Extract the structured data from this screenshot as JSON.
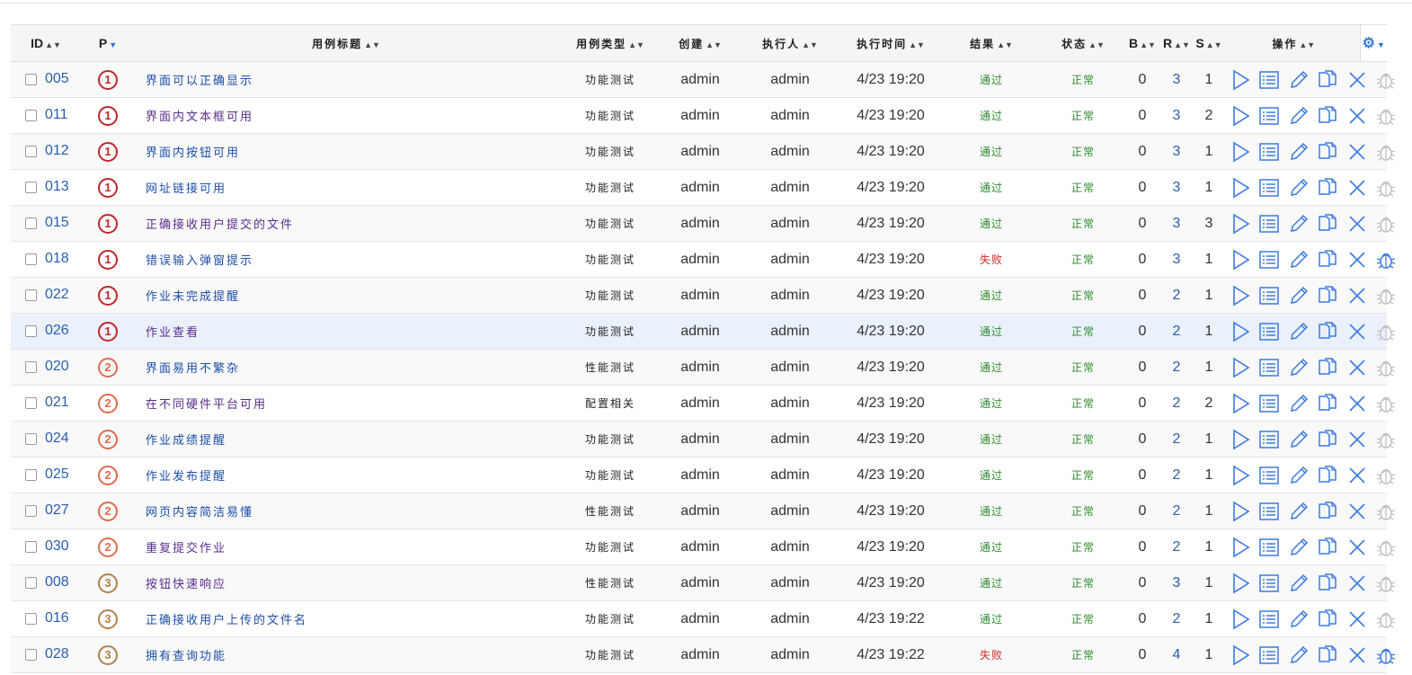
{
  "columns": {
    "id": "ID",
    "p": "P",
    "title": "用例标题",
    "type": "用例类型",
    "creator": "创建",
    "executor": "执行人",
    "time": "执行时间",
    "result": "结果",
    "status": "状态",
    "b": "B",
    "r": "R",
    "s": "S",
    "actions": "操作"
  },
  "icons": {
    "sort": "sort-icon",
    "settings": "gear-icon",
    "run": "play-icon",
    "results": "list-icon",
    "edit": "pencil-icon",
    "copy": "copy-icon",
    "delete": "close-icon",
    "bug": "bug-icon"
  },
  "colors": {
    "link": "#2a5db0",
    "pass": "#2e8b2e",
    "fail": "#d12a2a",
    "p1": "#c0262d",
    "p2": "#e06a4f",
    "p3": "#b3804a",
    "action": "#3b7be0"
  },
  "rows": [
    {
      "id": "005",
      "p": "1",
      "title": "界面可以正确显示",
      "type": "功能测试",
      "creator": "admin",
      "executor": "admin",
      "time": "4/23 19:20",
      "result": "通过",
      "status": "正常",
      "b": "0",
      "r": "3",
      "s": "1",
      "bug_active": false
    },
    {
      "id": "011",
      "p": "1",
      "title": "界面内文本框可用",
      "type": "功能测试",
      "creator": "admin",
      "executor": "admin",
      "time": "4/23 19:20",
      "result": "通过",
      "status": "正常",
      "b": "0",
      "r": "3",
      "s": "2",
      "bug_active": false
    },
    {
      "id": "012",
      "p": "1",
      "title": "界面内按钮可用",
      "type": "功能测试",
      "creator": "admin",
      "executor": "admin",
      "time": "4/23 19:20",
      "result": "通过",
      "status": "正常",
      "b": "0",
      "r": "3",
      "s": "1",
      "bug_active": false
    },
    {
      "id": "013",
      "p": "1",
      "title": "网址链接可用",
      "type": "功能测试",
      "creator": "admin",
      "executor": "admin",
      "time": "4/23 19:20",
      "result": "通过",
      "status": "正常",
      "b": "0",
      "r": "3",
      "s": "1",
      "bug_active": false
    },
    {
      "id": "015",
      "p": "1",
      "title": "正确接收用户提交的文件",
      "type": "功能测试",
      "creator": "admin",
      "executor": "admin",
      "time": "4/23 19:20",
      "result": "通过",
      "status": "正常",
      "b": "0",
      "r": "3",
      "s": "3",
      "bug_active": false
    },
    {
      "id": "018",
      "p": "1",
      "title": "错误输入弹窗提示",
      "type": "功能测试",
      "creator": "admin",
      "executor": "admin",
      "time": "4/23 19:20",
      "result": "失败",
      "status": "正常",
      "b": "0",
      "r": "3",
      "s": "1",
      "bug_active": true
    },
    {
      "id": "022",
      "p": "1",
      "title": "作业未完成提醒",
      "type": "功能测试",
      "creator": "admin",
      "executor": "admin",
      "time": "4/23 19:20",
      "result": "通过",
      "status": "正常",
      "b": "0",
      "r": "2",
      "s": "1",
      "bug_active": false
    },
    {
      "id": "026",
      "p": "1",
      "title": "作业查看",
      "type": "功能测试",
      "creator": "admin",
      "executor": "admin",
      "time": "4/23 19:20",
      "result": "通过",
      "status": "正常",
      "b": "0",
      "r": "2",
      "s": "1",
      "bug_active": false
    },
    {
      "id": "020",
      "p": "2",
      "title": "界面易用不繁杂",
      "type": "性能测试",
      "creator": "admin",
      "executor": "admin",
      "time": "4/23 19:20",
      "result": "通过",
      "status": "正常",
      "b": "0",
      "r": "2",
      "s": "1",
      "bug_active": false
    },
    {
      "id": "021",
      "p": "2",
      "title": "在不同硬件平台可用",
      "type": "配置相关",
      "creator": "admin",
      "executor": "admin",
      "time": "4/23 19:20",
      "result": "通过",
      "status": "正常",
      "b": "0",
      "r": "2",
      "s": "2",
      "bug_active": false
    },
    {
      "id": "024",
      "p": "2",
      "title": "作业成绩提醒",
      "type": "功能测试",
      "creator": "admin",
      "executor": "admin",
      "time": "4/23 19:20",
      "result": "通过",
      "status": "正常",
      "b": "0",
      "r": "2",
      "s": "1",
      "bug_active": false
    },
    {
      "id": "025",
      "p": "2",
      "title": "作业发布提醒",
      "type": "功能测试",
      "creator": "admin",
      "executor": "admin",
      "time": "4/23 19:20",
      "result": "通过",
      "status": "正常",
      "b": "0",
      "r": "2",
      "s": "1",
      "bug_active": false
    },
    {
      "id": "027",
      "p": "2",
      "title": "网页内容简洁易懂",
      "type": "性能测试",
      "creator": "admin",
      "executor": "admin",
      "time": "4/23 19:20",
      "result": "通过",
      "status": "正常",
      "b": "0",
      "r": "2",
      "s": "1",
      "bug_active": false
    },
    {
      "id": "030",
      "p": "2",
      "title": "重复提交作业",
      "type": "功能测试",
      "creator": "admin",
      "executor": "admin",
      "time": "4/23 19:20",
      "result": "通过",
      "status": "正常",
      "b": "0",
      "r": "2",
      "s": "1",
      "bug_active": false
    },
    {
      "id": "008",
      "p": "3",
      "title": "按钮快速响应",
      "type": "性能测试",
      "creator": "admin",
      "executor": "admin",
      "time": "4/23 19:20",
      "result": "通过",
      "status": "正常",
      "b": "0",
      "r": "3",
      "s": "1",
      "bug_active": false
    },
    {
      "id": "016",
      "p": "3",
      "title": "正确接收用户上传的文件名",
      "type": "功能测试",
      "creator": "admin",
      "executor": "admin",
      "time": "4/23 19:22",
      "result": "通过",
      "status": "正常",
      "b": "0",
      "r": "2",
      "s": "1",
      "bug_active": false
    },
    {
      "id": "028",
      "p": "3",
      "title": "拥有查询功能",
      "type": "功能测试",
      "creator": "admin",
      "executor": "admin",
      "time": "4/23 19:22",
      "result": "失败",
      "status": "正常",
      "b": "0",
      "r": "4",
      "s": "1",
      "bug_active": true
    }
  ]
}
